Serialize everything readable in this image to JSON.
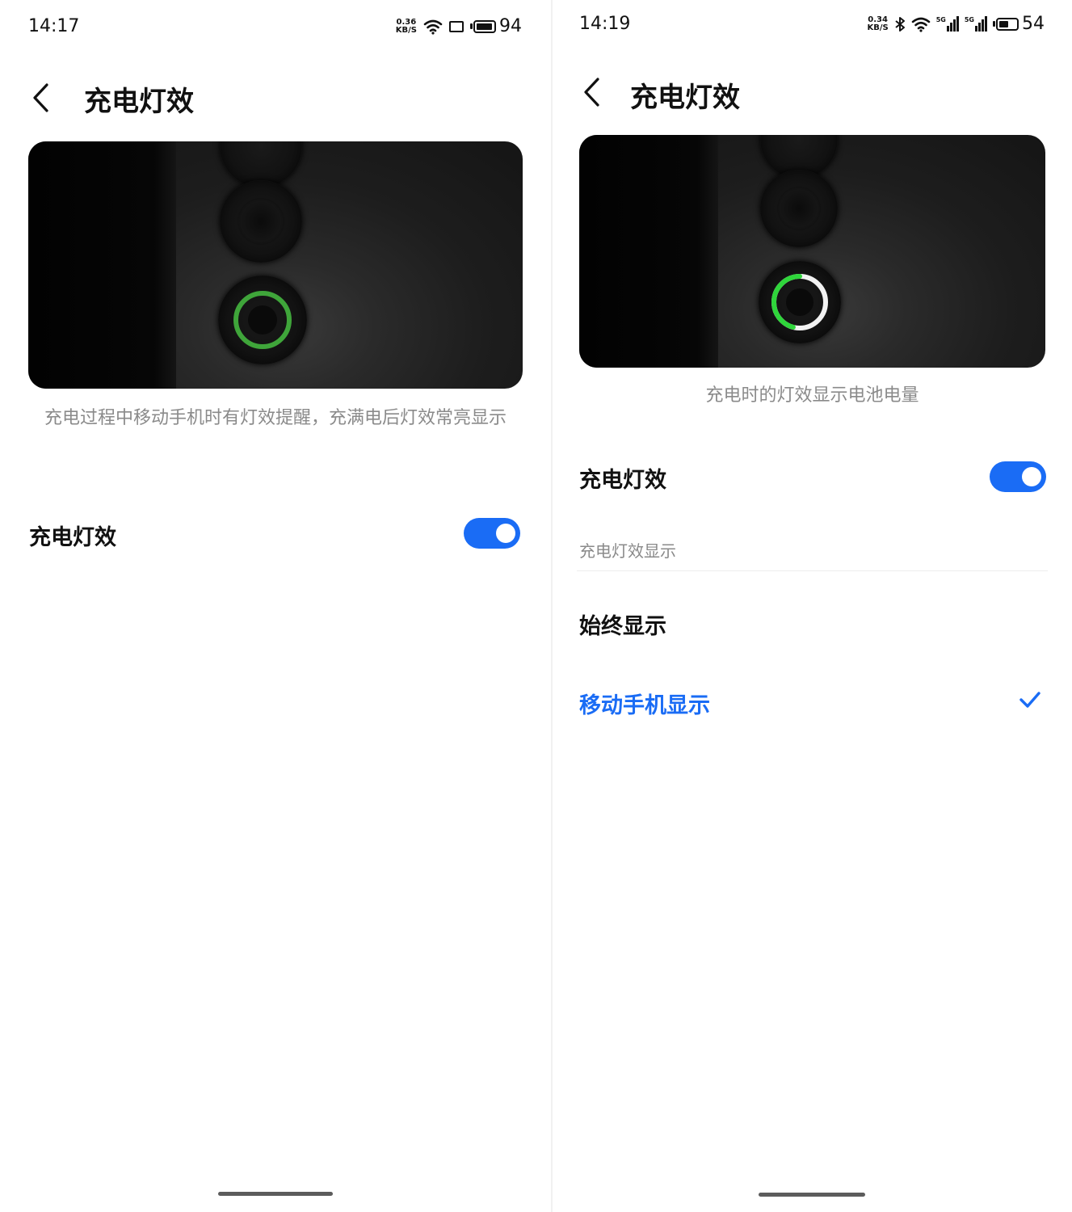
{
  "left": {
    "status": {
      "time": "14:17",
      "speed": "0.36",
      "speed_unit": "KB/S",
      "battery": "94",
      "battery_level": 0.94
    },
    "header": {
      "title": "充电灯效"
    },
    "description": "充电过程中移动手机时有灯效提醒，充满电后灯效常亮显示",
    "setting": {
      "label": "充电灯效",
      "enabled": true
    }
  },
  "right": {
    "status": {
      "time": "14:19",
      "speed": "0.34",
      "speed_unit": "KB/S",
      "battery": "54",
      "battery_level": 0.54,
      "sim1": "5G",
      "sim2": "5G"
    },
    "header": {
      "title": "充电灯效"
    },
    "description": "充电时的灯效显示电池电量",
    "setting": {
      "label": "充电灯效",
      "enabled": true
    },
    "section_title": "充电灯效显示",
    "options": [
      {
        "label": "始终显示",
        "selected": false
      },
      {
        "label": "移动手机显示",
        "selected": true
      }
    ]
  },
  "colors": {
    "accent": "#1a6cf5",
    "ring_green": "#3fa53a",
    "ring_bright": "#2fd63b"
  },
  "icons": [
    "back-arrow-icon",
    "wifi-icon",
    "bluetooth-icon",
    "signal-icon",
    "battery-icon",
    "tablet-icon",
    "check-icon"
  ]
}
